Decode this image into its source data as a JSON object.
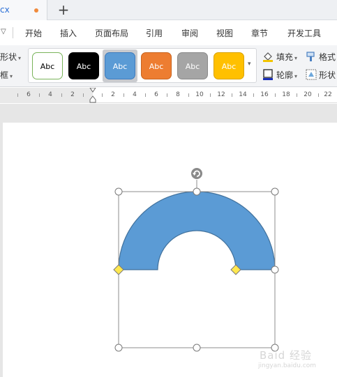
{
  "tabs": {
    "doc_name": "cx",
    "new_tab": "+"
  },
  "menu": {
    "more": "▽",
    "items": [
      "开始",
      "插入",
      "页面布局",
      "引用",
      "审阅",
      "视图",
      "章节",
      "开发工具"
    ]
  },
  "ribbon": {
    "left_labels": [
      "形状",
      "框"
    ],
    "style_swatches": [
      {
        "label": "Abc",
        "fill": "#ffffff",
        "border": "#79b45a",
        "text": "#000000"
      },
      {
        "label": "Abc",
        "fill": "#000000",
        "border": "#000000",
        "text": "#ffffff"
      },
      {
        "label": "Abc",
        "fill": "#5b9bd5",
        "border": "#3e7bbd",
        "text": "#ffffff"
      },
      {
        "label": "Abc",
        "fill": "#ed7d31",
        "border": "#c8641f",
        "text": "#ffffff"
      },
      {
        "label": "Abc",
        "fill": "#a5a5a5",
        "border": "#8a8a8a",
        "text": "#ffffff"
      },
      {
        "label": "Abc",
        "fill": "#ffc000",
        "border": "#d9a200",
        "text": "#ffffff"
      }
    ],
    "selected_swatch_index": 2,
    "gallery_more": "▾",
    "fill_label": "填充",
    "outline_label": "轮廓",
    "format_label": "格式",
    "shape_label": "形状"
  },
  "ruler": {
    "left_numbers": [
      "6",
      "4",
      "2"
    ],
    "right_numbers": [
      "2",
      "4",
      "6",
      "8",
      "10",
      "12",
      "14",
      "16",
      "18",
      "20",
      "22"
    ]
  },
  "shape": {
    "type": "block-arc",
    "fill": "#5b9bd5",
    "stroke": "#41719c"
  },
  "watermark": {
    "text": "Baid 经验",
    "sub": "jingyan.baidu.com"
  }
}
